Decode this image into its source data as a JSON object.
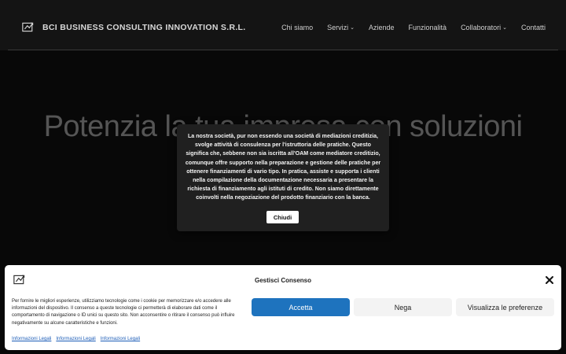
{
  "header": {
    "brand_name": "BCI BUSINESS CONSULTING INNOVATION S.R.L.",
    "nav": [
      {
        "label": "Chi siamo",
        "has_dropdown": false
      },
      {
        "label": "Servizi",
        "has_dropdown": true
      },
      {
        "label": "Aziende",
        "has_dropdown": false
      },
      {
        "label": "Funzionalità",
        "has_dropdown": false
      },
      {
        "label": "Collaboratori",
        "has_dropdown": true
      },
      {
        "label": "Contatti",
        "has_dropdown": false
      }
    ],
    "dropdown_icon": "chevron-down-icon"
  },
  "hero": {
    "title": "Potenzia la tua impresa con soluzioni"
  },
  "modal": {
    "text": "La nostra società, pur non essendo una società di mediazioni creditizia, svolge attività di consulenza per l'istruttoria delle pratiche. Questo significa che, sebbene non sia iscritta all'OAM come mediatore creditizio, comunque offre supporto nella preparazione e gestione delle pratiche per ottenere finanziamenti di vario tipo. In pratica, assiste e supporta i clienti nella compilazione della documentazione necessaria a presentare la richiesta di finanziamento agli istituti di credito. Non siamo direttamente coinvolti nella negoziazione del prodotto finanziario con la banca.",
    "close_label": "Chiudi"
  },
  "consent": {
    "title": "Gestisci Consenso",
    "text": "Per fornire le migliori esperienze, utilizziamo tecnologie come i cookie per memorizzare e/o accedere alle informazioni del dispositivo. Il consenso a queste tecnologie ci permetterà di elaborare dati come il comportamento di navigazione o ID unici su questo sito. Non acconsentire o ritirare il consenso può influire negativamente su alcune caratteristiche e funzioni.",
    "accept_label": "Accetta",
    "deny_label": "Nega",
    "prefs_label": "Visualizza le preferenze",
    "links": [
      "Informazioni Legali",
      "Informazioni Legali",
      "Informazioni Legali"
    ],
    "close_icon": "close-icon"
  },
  "colors": {
    "accent": "#1e73be",
    "background": "#0e0e0e",
    "modal_bg": "#202020"
  }
}
